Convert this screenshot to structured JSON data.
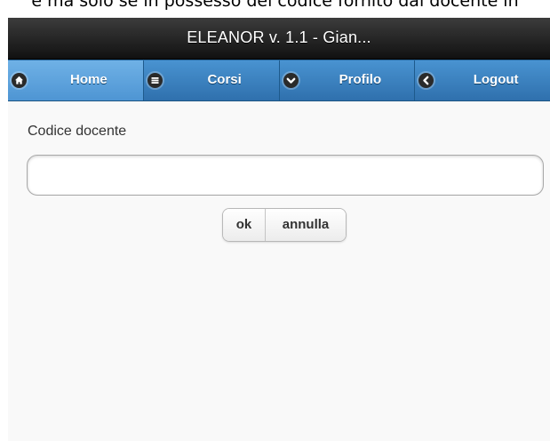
{
  "top_strip": {
    "text": "e ma solo se in possesso del codice fornito dal docente in"
  },
  "header": {
    "title": "ELEANOR v. 1.1 - Gian..."
  },
  "navbar": {
    "accent_color": "#3f85c5",
    "active_color": "#5ea3dd",
    "items": [
      {
        "label": "Home",
        "icon": "home-icon",
        "active": true
      },
      {
        "label": "Corsi",
        "icon": "menu-icon",
        "active": false
      },
      {
        "label": "Profilo",
        "icon": "chevron-down-icon",
        "active": false
      },
      {
        "label": "Logout",
        "icon": "chevron-left-icon",
        "active": false
      }
    ]
  },
  "form": {
    "label": "Codice docente",
    "input_value": "",
    "ok_label": "ok",
    "cancel_label": "annulla"
  }
}
